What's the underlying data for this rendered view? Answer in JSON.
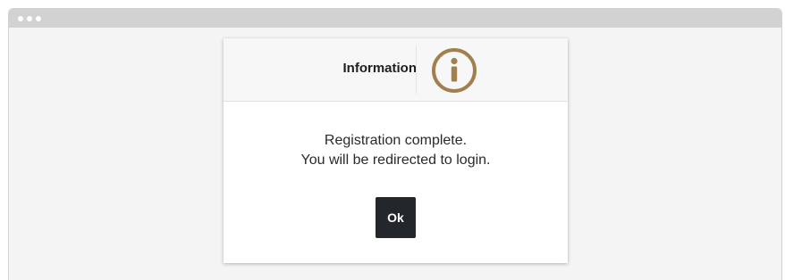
{
  "window": {
    "titlebar_color": "#d2d2d2"
  },
  "dialog": {
    "title": "Information",
    "icon": "info-circle-icon",
    "icon_color": "#a1804d",
    "message_lines": [
      "Registration complete.",
      "You will be redirected to login."
    ],
    "ok_label": "Ok",
    "ok_button_color": "#23262b"
  }
}
